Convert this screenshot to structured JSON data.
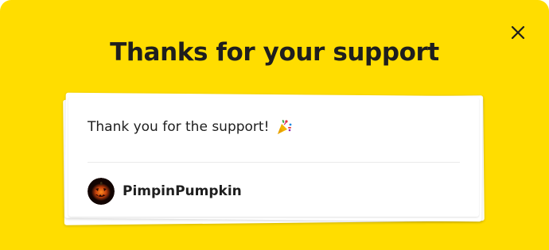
{
  "modal": {
    "title": "Thanks for your support",
    "close_icon": "close-icon",
    "background_color": "#ffdd00"
  },
  "support_card": {
    "message": "Thank you for the support!",
    "message_icon": "party-popper-icon",
    "supporter": {
      "name": "PimpinPumpkin",
      "avatar_icon": "pumpkin-avatar"
    }
  }
}
